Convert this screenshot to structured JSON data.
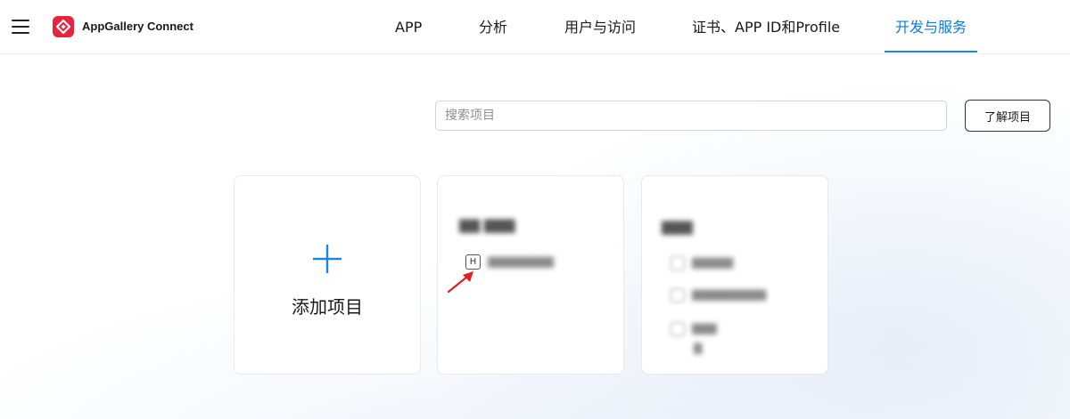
{
  "header": {
    "app_name": "AppGallery Connect",
    "nav": [
      {
        "label": "APP",
        "active": false
      },
      {
        "label": "分析",
        "active": false
      },
      {
        "label": "用户与访问",
        "active": false
      },
      {
        "label": "证书、APP ID和Profile",
        "active": false
      },
      {
        "label": "开发与服务",
        "active": true
      }
    ]
  },
  "search": {
    "placeholder": "搜索项目",
    "value": "",
    "learn_button_label": "了解项目"
  },
  "cards": {
    "add_project_label": "添加项目",
    "project_1": {
      "badge": "H"
    }
  },
  "colors": {
    "accent": "#0a7be6",
    "logo_red": "#e8233b",
    "arrow_red": "#e02020"
  }
}
